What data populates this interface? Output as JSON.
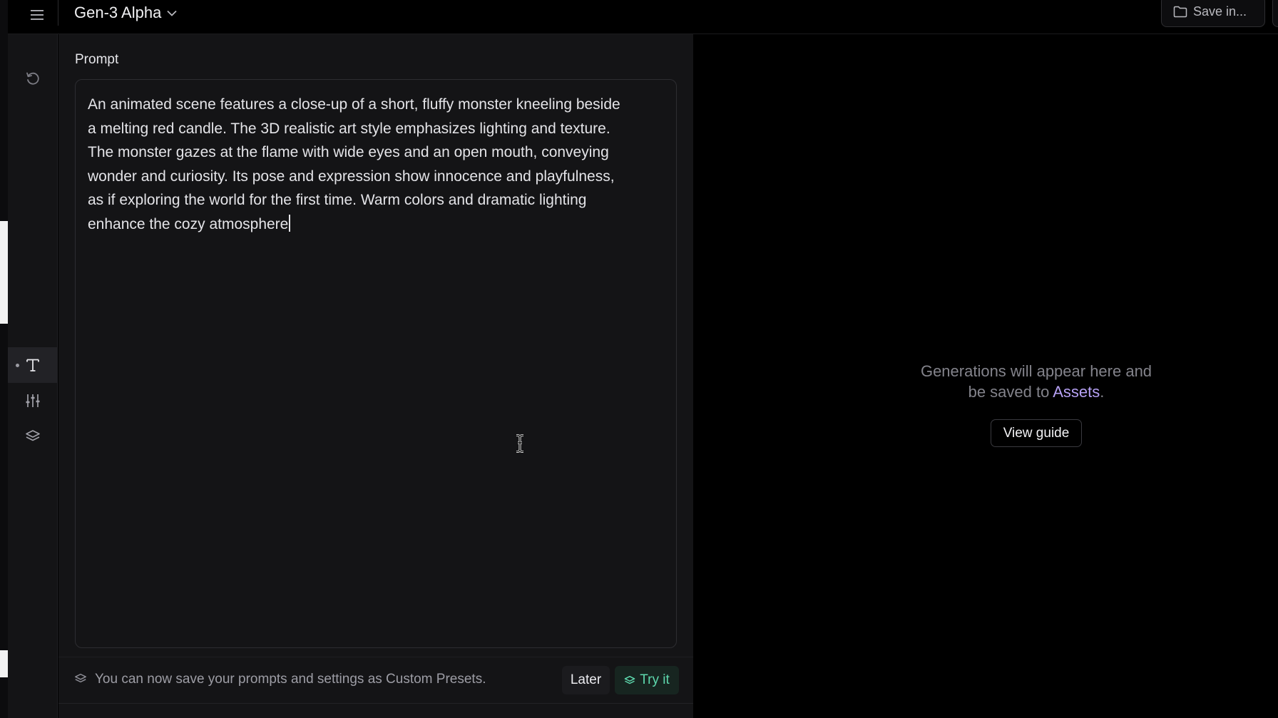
{
  "header": {
    "model_name": "Gen-3 Alpha",
    "save_label": "Save in..."
  },
  "prompt": {
    "label": "Prompt",
    "text": "An animated scene features a close-up of a short, fluffy monster kneeling beside\na melting red candle. The 3D realistic art style emphasizes lighting and texture.\nThe monster gazes at the flame with wide eyes and an open mouth, conveying\nwonder and curiosity. Its pose and expression show innocence and playfulness,\nas if exploring the world for the first time. Warm colors and dramatic lighting\nenhance the cozy atmosphere"
  },
  "notice": {
    "text": "You can now save your prompts and settings as Custom Presets.",
    "later_label": "Later",
    "try_label": "Try it"
  },
  "output": {
    "line1": "Generations will appear here and",
    "line2_prefix": "be saved to ",
    "assets_link": "Assets",
    "line2_suffix": ".",
    "guide_label": "View guide"
  },
  "rail": {
    "items": [
      "history-icon",
      "text-icon",
      "sliders-icon",
      "layers-icon"
    ],
    "active": "text-icon"
  },
  "colors": {
    "background": "#000000",
    "panel": "#141416",
    "accent_green": "#5ed8ad",
    "link_purple": "#b6a1f4"
  }
}
